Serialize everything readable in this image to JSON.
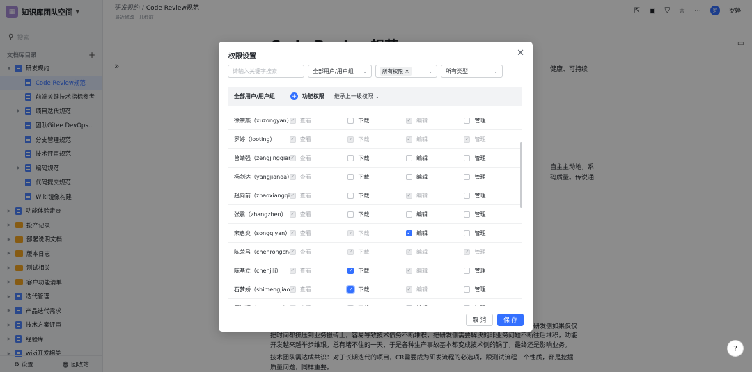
{
  "sidebar": {
    "space_title": "知识库团队空间",
    "search_placeholder": "搜索",
    "dir_label": "文档库目录",
    "items": [
      {
        "label": "研发规约",
        "icon": "doc-icon",
        "toggle": "▼",
        "indent": 0,
        "active": false
      },
      {
        "label": "Code Review规范",
        "icon": "doc-icon",
        "toggle": "",
        "indent": 1,
        "active": true
      },
      {
        "label": "前端关键技术指标参考",
        "icon": "doc-icon",
        "toggle": "",
        "indent": 1,
        "active": false
      },
      {
        "label": "项目迭代规范",
        "icon": "doc-icon",
        "toggle": "▶",
        "indent": 1,
        "active": false
      },
      {
        "label": "团队Gitee DevOps...",
        "icon": "doc-icon",
        "toggle": "",
        "indent": 1,
        "active": false
      },
      {
        "label": "分支管理规范",
        "icon": "doc-icon",
        "toggle": "",
        "indent": 1,
        "active": false
      },
      {
        "label": "技术评审规范",
        "icon": "doc-icon",
        "toggle": "",
        "indent": 1,
        "active": false
      },
      {
        "label": "编码规范",
        "icon": "doc-icon",
        "toggle": "▶",
        "indent": 1,
        "active": false
      },
      {
        "label": "代码提交规范",
        "icon": "doc-icon",
        "toggle": "",
        "indent": 1,
        "active": false
      },
      {
        "label": "Wiki镜像构建",
        "icon": "doc-icon",
        "toggle": "",
        "indent": 1,
        "active": false
      },
      {
        "label": "功能体验走查",
        "icon": "doc-icon",
        "toggle": "▶",
        "indent": 0,
        "active": false
      },
      {
        "label": "投产记录",
        "icon": "folder-icon",
        "toggle": "▶",
        "indent": 0,
        "active": false
      },
      {
        "label": "部署说明文档",
        "icon": "folder-icon",
        "toggle": "▶",
        "indent": 0,
        "active": false
      },
      {
        "label": "版本日志",
        "icon": "folder-icon",
        "toggle": "▶",
        "indent": 0,
        "active": false
      },
      {
        "label": "测试相关",
        "icon": "folder-icon",
        "toggle": "▶",
        "indent": 0,
        "active": false
      },
      {
        "label": "客户功能清单",
        "icon": "folder-icon",
        "toggle": "▶",
        "indent": 0,
        "active": false
      },
      {
        "label": "迭代管理",
        "icon": "doc-icon",
        "toggle": "▶",
        "indent": 0,
        "active": false
      },
      {
        "label": "产品迭代需求",
        "icon": "doc-icon",
        "toggle": "▶",
        "indent": 0,
        "active": false
      },
      {
        "label": "技术方案评审",
        "icon": "doc-icon",
        "toggle": "▶",
        "indent": 0,
        "active": false
      },
      {
        "label": "经验库",
        "icon": "doc-icon",
        "toggle": "▶",
        "indent": 0,
        "active": false
      },
      {
        "label": "wiki开发相关",
        "icon": "doc-icon",
        "toggle": "▶",
        "indent": 0,
        "active": false
      }
    ],
    "settings_label": "设置",
    "trash_label": "回收站"
  },
  "header": {
    "breadcrumb_parent": "研发规约",
    "breadcrumb_sep": "/",
    "breadcrumb_current": "Code Review规范",
    "subline": "最近修改 · 几秒前",
    "user_name": "罗婷",
    "avatar_text": "罗"
  },
  "document": {
    "title": "Code Review规范",
    "right_snippets": [
      "健康、可持续",
      "自主主动地，系",
      "码质量。传说通"
    ],
    "bottom_para1": [
      "把时间都挤压到业务搬砖上，容易导致技术债务不断堆积，把研发侧需要解决的非业务问题不断往后堆积，功能",
      "开发越来越举步维艰，总有堵不住的一天，于是各种生产事故基本都变成技术侧的锅了，最终还是影响业务。"
    ],
    "bottom_right_snippet": "研发侧如果仅仅",
    "bottom_para2": [
      "技术团队需达成共识：对于长期迭代的项目，CR需要成为研发流程的必选项，跟测试流程一个性质，都是挖掘",
      "质量问题，同样重要。"
    ]
  },
  "modal": {
    "title": "权限设置",
    "search_placeholder": "请输入关键字搜索",
    "filter_users": "全部用户/用户组",
    "filter_perm_tag": "所有权限",
    "filter_type": "所有类型",
    "table_header_users": "全部用户/用户组",
    "table_header_func": "功能权限",
    "table_header_inherit": "继承上一级权限",
    "perm_labels": {
      "view": "查看",
      "download": "下载",
      "edit": "编辑",
      "manage": "管理"
    },
    "rows": [
      {
        "name": "徐宗燕（xuzongyan）",
        "view": "dis-on",
        "download": "off",
        "edit": "dis-on",
        "manage": "off"
      },
      {
        "name": "罗婷（looting）",
        "view": "dis-on",
        "download": "dis-on",
        "edit": "dis-on",
        "manage": "dis-on"
      },
      {
        "name": "曾靖强（zengjingqiang...",
        "view": "dis-on",
        "download": "off",
        "edit": "off",
        "manage": "off"
      },
      {
        "name": "杨剑达（yangjianda）",
        "view": "dis-on",
        "download": "off",
        "edit": "off",
        "manage": "off"
      },
      {
        "name": "赵向前（zhaoxiangqia...",
        "view": "dis-on",
        "download": "off",
        "edit": "dis-on",
        "manage": "off"
      },
      {
        "name": "张震（zhangzhen）",
        "view": "dis-on",
        "download": "off",
        "edit": "off",
        "manage": "off"
      },
      {
        "name": "宋启炎（songqiyan）",
        "view": "dis-on",
        "download": "dis-on",
        "edit": "on",
        "manage": "off"
      },
      {
        "name": "陈荣昌（chenrongcha...",
        "view": "dis-on",
        "download": "dis-on",
        "edit": "dis-on",
        "manage": "dis-on"
      },
      {
        "name": "陈基立（chenjili）",
        "view": "dis-on",
        "download": "on",
        "edit": "dis-on",
        "manage": "off"
      },
      {
        "name": "石梦娇（shimengjiao）",
        "view": "dis-on",
        "download": "focus",
        "edit": "dis-on",
        "manage": "off"
      },
      {
        "name": "邱树辉（qiushuhui）",
        "view": "dis-on",
        "download": "off",
        "edit": "off",
        "manage": "off"
      }
    ],
    "cancel_label": "取 消",
    "save_label": "保 存"
  },
  "colors": {
    "accent": "#3370ff",
    "sidebar_bg": "#f5f6f7",
    "overlay": "rgba(0,0,0,0.45)"
  }
}
